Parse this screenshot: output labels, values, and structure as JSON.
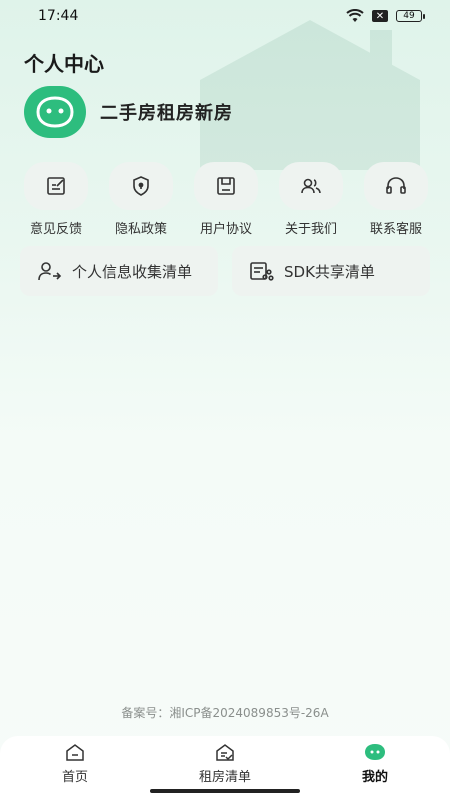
{
  "status_bar": {
    "time": "17:44",
    "battery": "49"
  },
  "page": {
    "title": "个人中心"
  },
  "profile": {
    "app_name": "二手房租房新房"
  },
  "quick_actions": [
    {
      "label": "意见反馈",
      "icon": "feedback-icon"
    },
    {
      "label": "隐私政策",
      "icon": "shield-icon"
    },
    {
      "label": "用户协议",
      "icon": "document-icon"
    },
    {
      "label": "关于我们",
      "icon": "users-icon"
    },
    {
      "label": "联系客服",
      "icon": "headset-icon"
    }
  ],
  "lists": [
    {
      "label": "个人信息收集清单",
      "icon": "user-info-icon"
    },
    {
      "label": "SDK共享清单",
      "icon": "share-list-icon"
    }
  ],
  "footer": {
    "icp": "备案号：湘ICP备2024089853号-26A"
  },
  "tab_bar": {
    "tabs": [
      {
        "label": "首页",
        "icon": "home-icon",
        "active": false
      },
      {
        "label": "租房清单",
        "icon": "house-list-icon",
        "active": false
      },
      {
        "label": "我的",
        "icon": "profile-face-icon",
        "active": true
      }
    ]
  },
  "colors": {
    "accent": "#2dbd7e",
    "card_bg": "#eef3f0"
  }
}
